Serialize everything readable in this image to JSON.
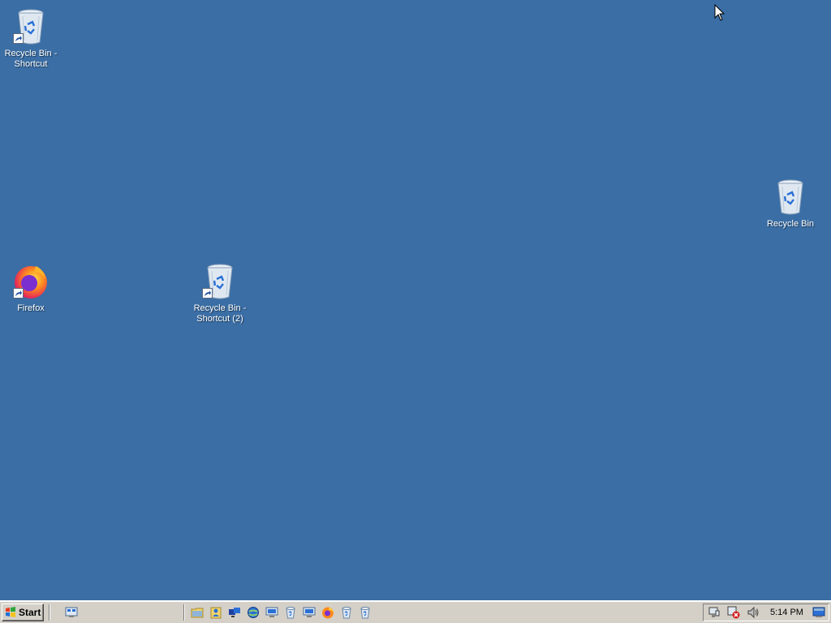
{
  "desktop": {
    "icons": [
      {
        "label": "Recycle Bin - Shortcut",
        "type": "recycle-bin",
        "shortcut": true
      },
      {
        "label": "Firefox",
        "type": "firefox",
        "shortcut": true
      },
      {
        "label": "Recycle Bin - Shortcut (2)",
        "type": "recycle-bin",
        "shortcut": true
      },
      {
        "label": "Recycle Bin",
        "type": "recycle-bin",
        "shortcut": false
      }
    ]
  },
  "taskbar": {
    "start_label": "Start",
    "quick_launch": [
      "show-desktop-icon",
      "folder-icon",
      "user-icon",
      "network-icon",
      "internet-icon",
      "computer-icon",
      "recycle-bin-icon",
      "computer-icon",
      "firefox-icon",
      "recycle-bin-icon",
      "recycle-bin-icon"
    ],
    "tray": {
      "icons": [
        "network-icon",
        "security-warning-icon",
        "volume-icon",
        "display-icon"
      ],
      "clock": "5:14 PM"
    }
  },
  "colors": {
    "desktop_bg": "#3a6ea5",
    "taskbar_bg": "#d4d0c8",
    "label_text": "#ffffff"
  }
}
